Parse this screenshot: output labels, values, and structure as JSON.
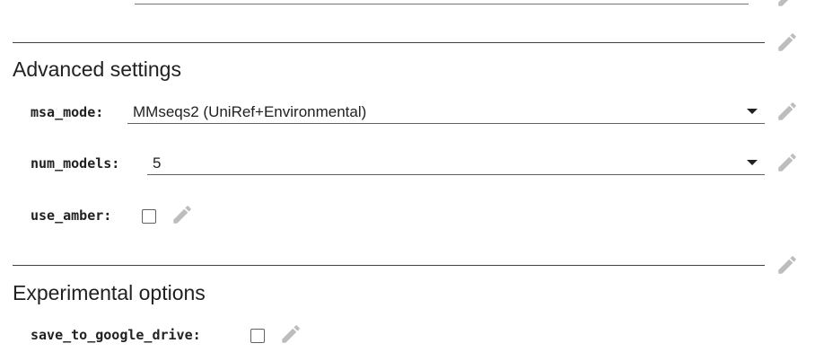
{
  "advanced": {
    "heading": "Advanced settings",
    "msa_mode": {
      "label": "msa_mode:",
      "value": "MMseqs2 (UniRef+Environmental)"
    },
    "num_models": {
      "label": "num_models:",
      "value": "5"
    },
    "use_amber": {
      "label": "use_amber:",
      "checked": false
    }
  },
  "experimental": {
    "heading": "Experimental options",
    "save_to_google_drive": {
      "label": "save_to_google_drive:",
      "checked": false
    }
  },
  "icons": {
    "edit": "pencil-icon"
  },
  "colors": {
    "rule": "#424242",
    "icon": "#bdbdbd",
    "text": "#212121"
  }
}
